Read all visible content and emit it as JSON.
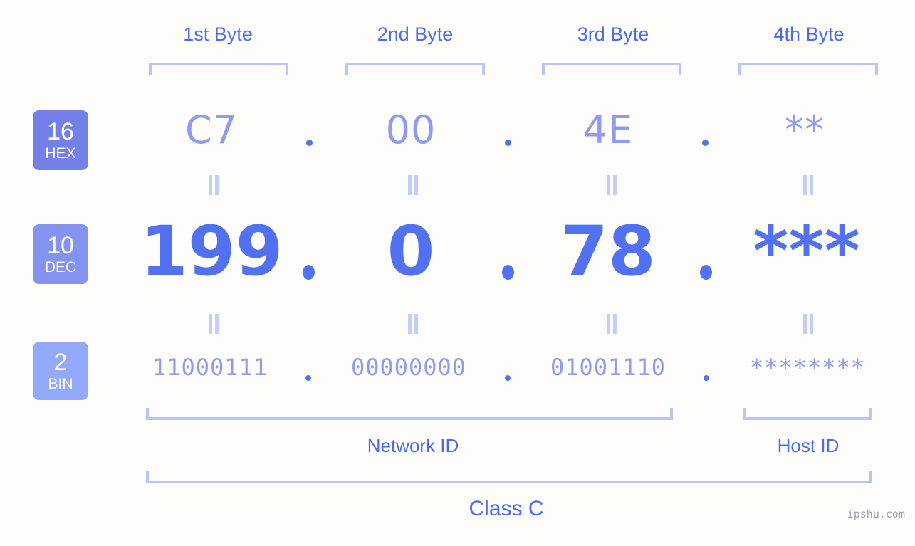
{
  "watermark": "ipshu.com",
  "byte_headers": [
    {
      "label": "1st Byte"
    },
    {
      "label": "2nd Byte"
    },
    {
      "label": "3rd Byte"
    },
    {
      "label": "4th Byte"
    }
  ],
  "bases": [
    {
      "number": "16",
      "name": "HEX",
      "color": "#7380e8"
    },
    {
      "number": "10",
      "name": "DEC",
      "color": "#8593f0"
    },
    {
      "number": "2",
      "name": "BIN",
      "color": "#93aafa"
    }
  ],
  "rows": {
    "hex": {
      "base_number": "16",
      "base_name": "HEX",
      "values": [
        "C7",
        "00",
        "4E",
        "**"
      ],
      "separator": "."
    },
    "dec": {
      "base_number": "10",
      "base_name": "DEC",
      "values": [
        "199",
        "0",
        "78",
        "***"
      ],
      "separator": "."
    },
    "bin": {
      "base_number": "2",
      "base_name": "BIN",
      "values": [
        "11000111",
        "00000000",
        "01001110",
        "********"
      ],
      "separator": "."
    }
  },
  "equality_symbol": "=",
  "sections": {
    "network_id": "Network ID",
    "host_id": "Host ID",
    "class": "Class C"
  },
  "colors": {
    "background": "#fdfdfb",
    "accent_strong": "#4b6bef",
    "accent_dec": "#5271f0",
    "accent_light": "#8e9bf0",
    "bracket": "#b9c4f7",
    "badge_hex": "#7380e8",
    "badge_dec": "#8593f0",
    "badge_bin": "#93aafa",
    "watermark": "#9aa0ad"
  }
}
